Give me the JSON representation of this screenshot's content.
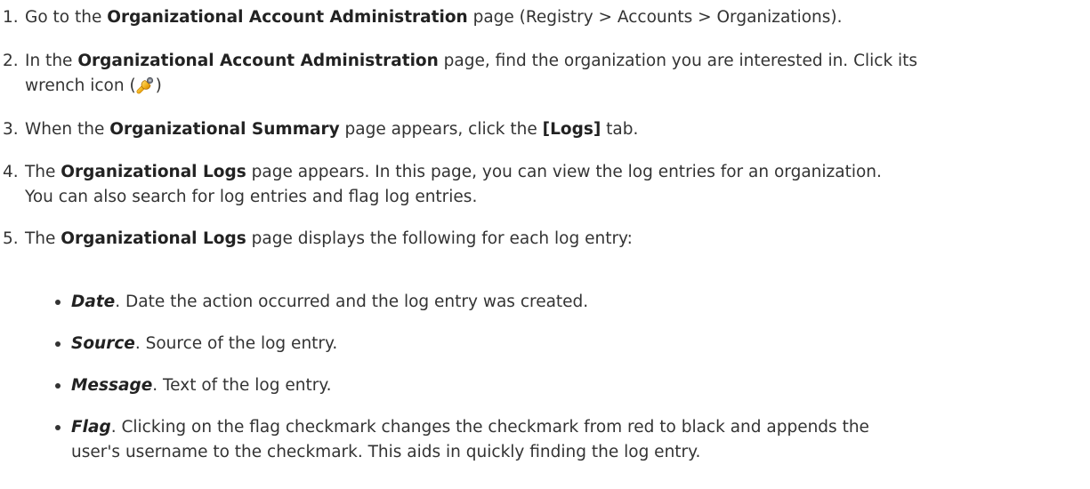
{
  "steps": [
    {
      "num": "1.",
      "a": "Go to the ",
      "b": "Organizational Account Administration",
      "c": " page (Registry > Accounts > Organizations)."
    },
    {
      "num": "2.",
      "a": "In the ",
      "b": "Organizational Account Administration",
      "c": " page, find the organization you are interested in. Click its",
      "d": "wrench icon (",
      "icon": "wrench-icon",
      "e": ")"
    },
    {
      "num": "3.",
      "a": "When the ",
      "b": "Organizational Summary",
      "c": " page appears, click the ",
      "d": "[Logs]",
      "e": " tab."
    },
    {
      "num": "4.",
      "a": "The ",
      "b": "Organizational Logs",
      "c": " page appears. In this page, you can view the log entries for an organization.",
      "d": "You can also search for log entries and flag log entries."
    },
    {
      "num": "5.",
      "a": "The ",
      "b": "Organizational Logs",
      "c": " page displays the following for each log entry:"
    }
  ],
  "bullets": [
    {
      "term": "Date",
      "desc": ". Date the action occurred and the log entry was created."
    },
    {
      "term": "Source",
      "desc": ". Source of the log entry."
    },
    {
      "term": "Message",
      "desc": ". Text of the log entry."
    },
    {
      "term": "Flag",
      "desc": ". Clicking on the flag checkmark changes the checkmark from red to black and appends the",
      "desc2": "user's username to the checkmark. This aids in quickly finding the log entry."
    }
  ]
}
